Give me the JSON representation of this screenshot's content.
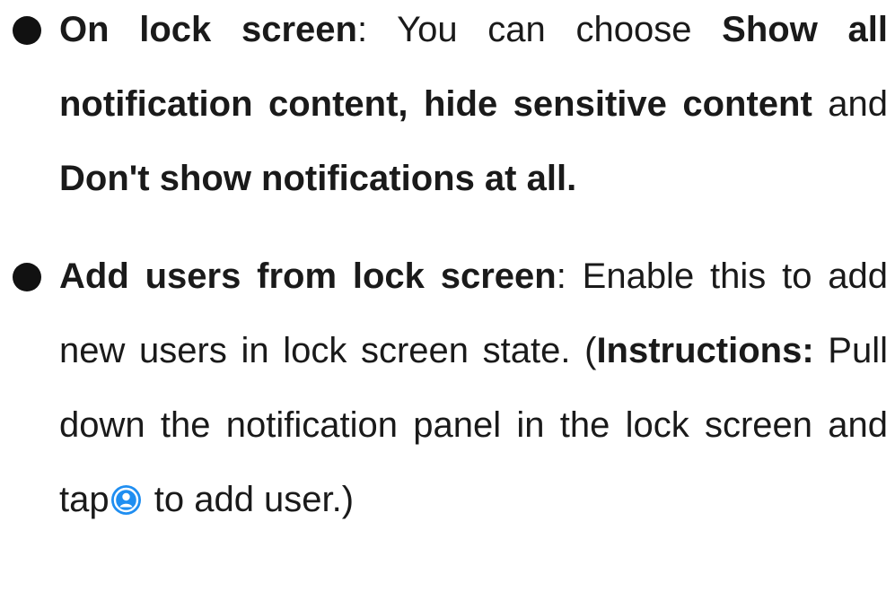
{
  "items": [
    {
      "term": "On lock screen",
      "sep": ": ",
      "text1": "You can choose ",
      "b1": "Show all notification content, hide sensitive content",
      "text2": " and ",
      "b2": "Don't show notifications at all."
    },
    {
      "term": "Add users from lock screen",
      "sep": ": ",
      "text1": "Enable this to add new users in lock screen state. (",
      "b1": "Instructions:",
      "text2": " Pull down the notification panel in the lock screen and tap",
      "icon": "user-account-icon",
      "text3": " to add user.)"
    }
  ],
  "colors": {
    "text": "#1a1a1a",
    "icon_accent": "#1f8ef1"
  }
}
